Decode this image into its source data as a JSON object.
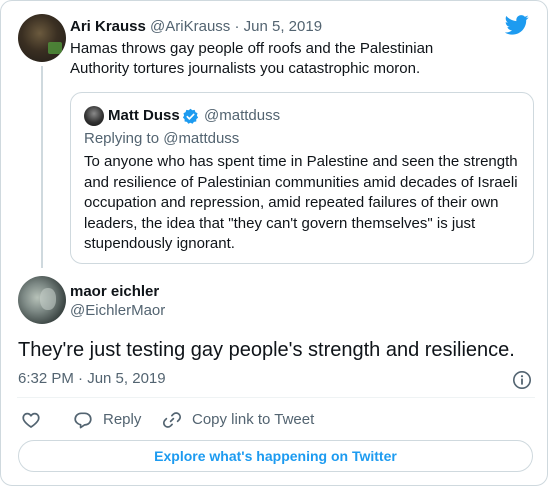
{
  "colors": {
    "accent": "#1d9bf0",
    "text": "#0f1419",
    "secondary": "#536471",
    "border": "#cfd9de"
  },
  "parent_tweet": {
    "name": "Ari Krauss",
    "handle": "@AriKrauss",
    "separator": "·",
    "date": "Jun 5, 2019",
    "text": "Hamas throws gay people off roofs and the Palestinian Authority tortures journalists you catastrophic moron."
  },
  "quoted_tweet": {
    "name": "Matt Duss",
    "handle": "@mattduss",
    "replying_to": "Replying to @mattduss",
    "text": "To anyone who has spent time in Palestine and seen the strength and resilience of Palestinian communities amid decades of Israeli occupation and repression, amid repeated failures of their own leaders, the idea that \"they can't govern themselves\" is just stupendously ignorant."
  },
  "main_tweet": {
    "name": "maor eichler",
    "handle": "@EichlerMaor",
    "text": "They're just testing gay people's strength and resilience.",
    "timestamp": "6:32 PM · Jun 5, 2019"
  },
  "actions": {
    "reply_label": "Reply",
    "copy_link_label": "Copy link to Tweet"
  },
  "explore_label": "Explore what's happening on Twitter",
  "icons": [
    "twitter-logo-icon",
    "verified-badge-icon",
    "info-icon",
    "heart-icon",
    "reply-icon",
    "link-icon"
  ]
}
